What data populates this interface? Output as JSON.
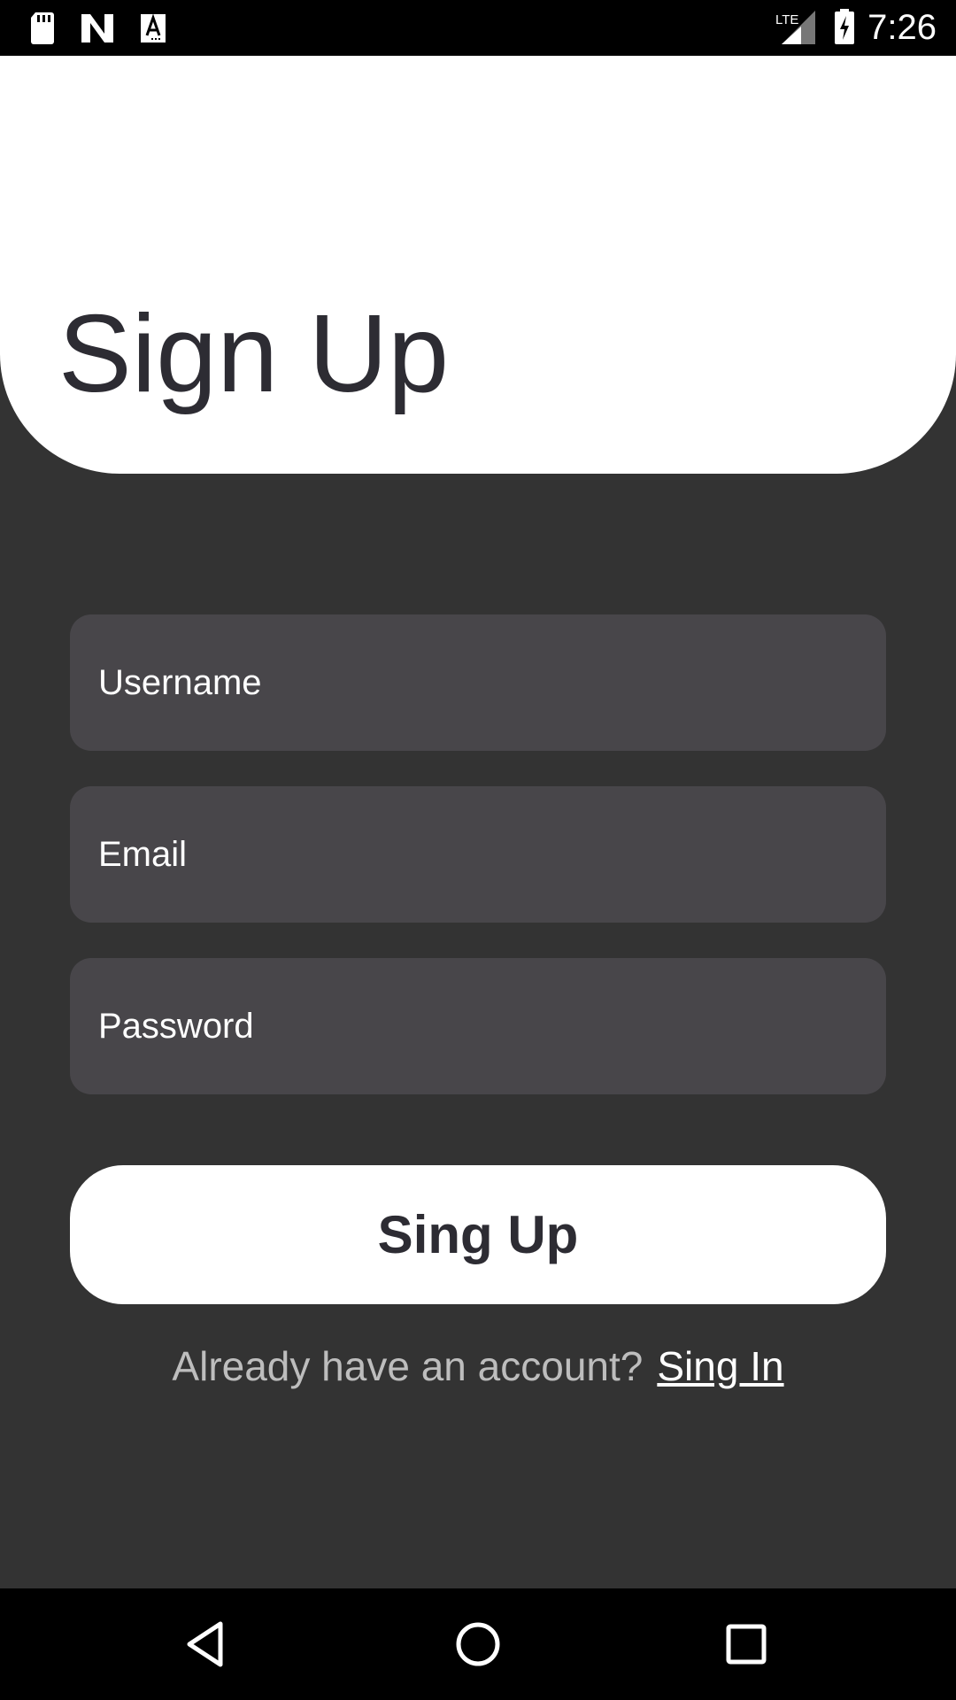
{
  "status_bar": {
    "time": "7:26",
    "left_icons": [
      "sd-card-icon",
      "n-notification-icon",
      "a-notification-icon"
    ],
    "right_icons": [
      "lte-signal-icon",
      "battery-charging-icon"
    ]
  },
  "header": {
    "title": "Sign Up"
  },
  "form": {
    "username_placeholder": "Username",
    "email_placeholder": "Email",
    "password_placeholder": "Password",
    "submit_label": "Sing Up"
  },
  "footer_prompt": {
    "text": "Already have an account?",
    "link": "Sing In"
  },
  "nav_bar": {
    "icons": [
      "back-icon",
      "home-icon",
      "recents-icon"
    ]
  },
  "colors": {
    "background": "#333333",
    "header": "#ffffff",
    "field": "#48464a",
    "title_text": "#2d2c33",
    "prompt_text": "#bdbdbd"
  }
}
